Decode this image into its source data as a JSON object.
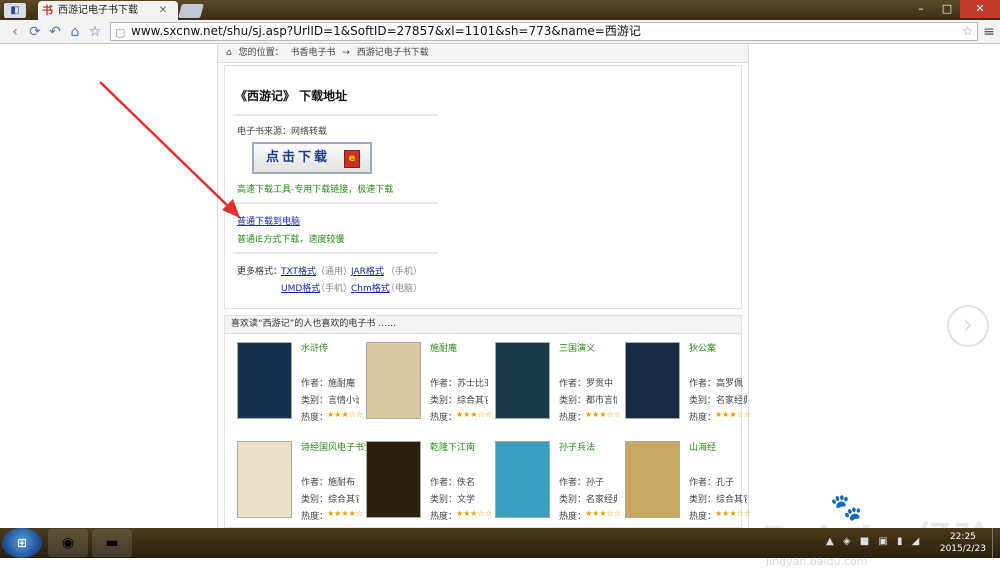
{
  "browser": {
    "tab_title": "西游记电子书下载",
    "tab_logo": "书",
    "url": "www.sxcnw.net/shu/sj.asp?UrlID=1&SoftID=27857&xl=1101&sh=773&name=西游记"
  },
  "breadcrumb": [
    "您的位置：",
    "书香电子书",
    "→",
    "西游记电子书下载"
  ],
  "download": {
    "title": "《西游记》 下载地址",
    "source": "电子书来源：网络转载",
    "button_label": "点击下载",
    "tool_text": "高速下载工具-专用下载链接，极速下载",
    "normal_link": "普通下载到电脑",
    "normal_desc": "普通IE方式下载，速度较慢",
    "more_label": "更多格式：",
    "formats": [
      {
        "name": "TXT格式",
        "note": "（通用）"
      },
      {
        "name": "JAR格式",
        "note": "（手机）"
      },
      {
        "name": "UMD格式",
        "note": "（手机）"
      },
      {
        "name": "Chm格式",
        "note": "（电脑）"
      }
    ]
  },
  "recommend": {
    "heading": "喜欢读“西游记”的人也喜欢的电子书 ……",
    "books": [
      {
        "name": "水浒传",
        "author": "作者：施耐庵",
        "type": "类别：言情小说",
        "rating": "热度：",
        "stars": "★★★☆☆",
        "cover_color": "#1a3050"
      },
      {
        "name": "施耐庵",
        "author": "作者：苏士比亚",
        "type": "类别：综合其它",
        "rating": "热度：",
        "stars": "★★★☆☆",
        "cover_color": "#d8c8a0"
      },
      {
        "name": "三国演义",
        "author": "作者：罗贯中",
        "type": "类别：都市言情",
        "rating": "热度：",
        "stars": "★★★☆☆",
        "cover_color": "#1a3a48"
      },
      {
        "name": "狄公案",
        "author": "作者：高罗佩",
        "type": "类别：名家经典",
        "rating": "热度：",
        "stars": "★★★☆☆",
        "cover_color": "#1a2a40"
      },
      {
        "name": "诗经国风电子书全本下载",
        "author": "作者：施耐布",
        "type": "类别：综合其它",
        "rating": "热度：",
        "stars": "★★★★☆",
        "cover_color": "#e8e0c8"
      },
      {
        "name": "乾隆下江南",
        "author": "作者：佚名",
        "type": "类别：文学",
        "rating": "热度：",
        "stars": "★★★☆☆",
        "cover_color": "#2a2010"
      },
      {
        "name": "孙子兵法",
        "author": "作者：孙子",
        "type": "类别：名家经典",
        "rating": "热度：",
        "stars": "★★★☆☆",
        "cover_color": "#3aa0c0"
      },
      {
        "name": "山海经",
        "author": "作者：孔子",
        "type": "类别：综合其它",
        "rating": "热度：",
        "stars": "★★★☆☆",
        "cover_color": "#c8a860"
      }
    ]
  },
  "watermark": {
    "main": "Bai du 经验",
    "url": "jingyan.baidu.com"
  },
  "taskbar": {
    "time": "22:25",
    "date": "2015/2/23"
  },
  "colors": {
    "link": "#1a2a9a",
    "green_text": "#2a8a1a",
    "arrow": "#e03030"
  }
}
